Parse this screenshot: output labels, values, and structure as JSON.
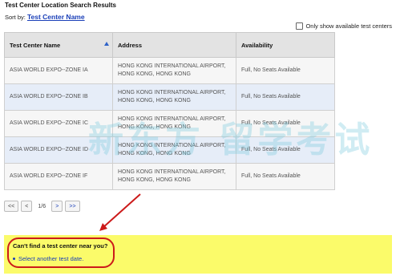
{
  "page": {
    "title": "Test Center Location Search Results",
    "sort_prefix": "Sort by:",
    "sort_link": "Test Center Name",
    "only_available_label": "Only show available test centers"
  },
  "table": {
    "headers": [
      "Test Center Name",
      "Address",
      "Availability"
    ],
    "rows": [
      {
        "name": "ASIA WORLD EXPO--ZONE IA",
        "address_line1": "HONG KONG INTERNATIONAL AIRPORT,",
        "address_line2": "HONG KONG, HONG KONG",
        "availability": "Full, No Seats Available"
      },
      {
        "name": "ASIA WORLD EXPO--ZONE IB",
        "address_line1": "HONG KONG INTERNATIONAL AIRPORT,",
        "address_line2": "HONG KONG, HONG KONG",
        "availability": "Full, No Seats Available"
      },
      {
        "name": "ASIA WORLD EXPO--ZONE IC",
        "address_line1": "HONG KONG INTERNATIONAL AIRPORT,",
        "address_line2": "HONG KONG, HONG KONG",
        "availability": "Full, No Seats Available"
      },
      {
        "name": "ASIA WORLD EXPO--ZONE ID",
        "address_line1": "HONG KONG INTERNATIONAL AIRPORT,",
        "address_line2": "HONG KONG, HONG KONG",
        "availability": "Full, No Seats Available"
      },
      {
        "name": "ASIA WORLD EXPO--ZONE IF",
        "address_line1": "HONG KONG INTERNATIONAL AIRPORT,",
        "address_line2": "HONG KONG, HONG KONG",
        "availability": "Full, No Seats Available"
      }
    ]
  },
  "pager": {
    "first": "<<",
    "prev": "<",
    "page_info": "1/6",
    "next": ">",
    "last": ">>"
  },
  "notice": {
    "title": "Can't find a test center near you?",
    "link": "Select another test date."
  },
  "watermark": {
    "text": "新东方 留学考试"
  },
  "colors": {
    "link_blue": "#1a3fb8",
    "notice_yellow": "#fbfb6a",
    "annotation_red": "#cc1a1a",
    "row_alt_blue": "#e6edf8"
  }
}
